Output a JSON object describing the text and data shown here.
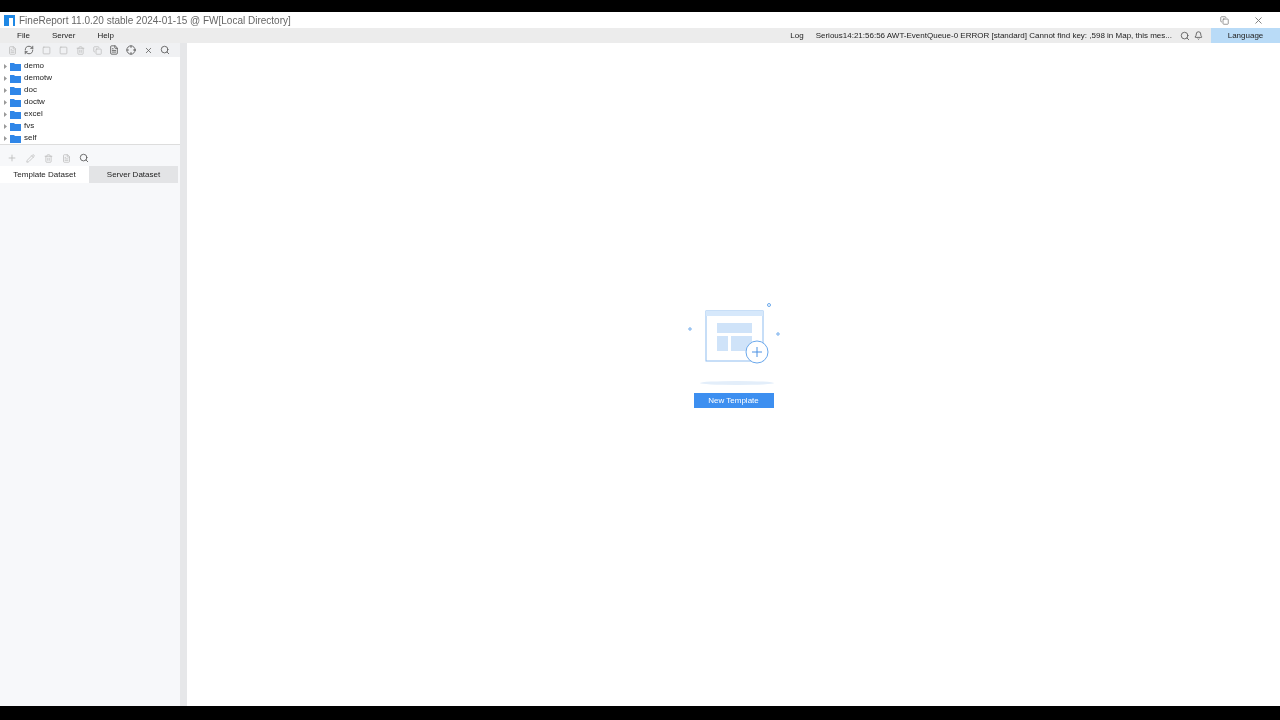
{
  "window": {
    "title": "FineReport 11.0.20 stable 2024-01-15 @ FW[Local Directory]"
  },
  "menu": [
    "File",
    "Server",
    "Help"
  ],
  "log": {
    "label": "Log",
    "message": "Serious14:21:56:56 AWT-EventQueue-0 ERROR [standard] Cannot find key: ,598 in Map, this mes..."
  },
  "language_button": "Language",
  "tree": [
    {
      "label": "demo"
    },
    {
      "label": "demotw"
    },
    {
      "label": "doc"
    },
    {
      "label": "doctw"
    },
    {
      "label": "excel"
    },
    {
      "label": "fvs"
    },
    {
      "label": "self"
    }
  ],
  "dataset_tabs": [
    {
      "label": "Template Dataset",
      "selected": true
    },
    {
      "label": "Server Dataset",
      "selected": false
    }
  ],
  "empty_state": {
    "button": "New Template"
  }
}
